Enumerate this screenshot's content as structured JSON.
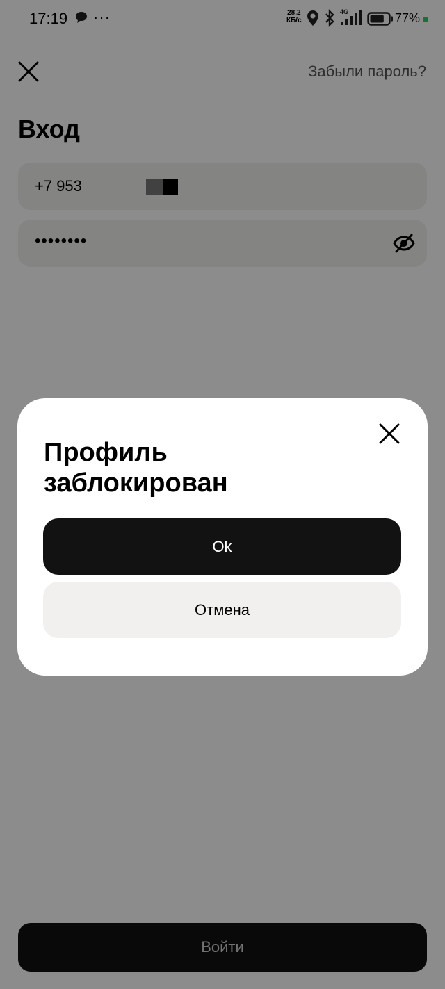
{
  "status_bar": {
    "time": "17:19",
    "dots": "···",
    "speed_value": "28,2",
    "speed_unit": "КБ/с",
    "network": "4G",
    "battery_pct": "77%",
    "battery_level": 0.77
  },
  "header": {
    "forgot_password": "Забыли пароль?",
    "title": "Вход"
  },
  "form": {
    "phone_value": "+7 953",
    "password_value": "••••••••"
  },
  "modal": {
    "title": "Профиль заблокирован",
    "ok_label": "Ok",
    "cancel_label": "Отмена"
  },
  "footer": {
    "login_label": "Войти"
  },
  "colors": {
    "dark": "#121212",
    "field_bg": "#f1f0ee",
    "status_dot": "#2dcf5a"
  }
}
